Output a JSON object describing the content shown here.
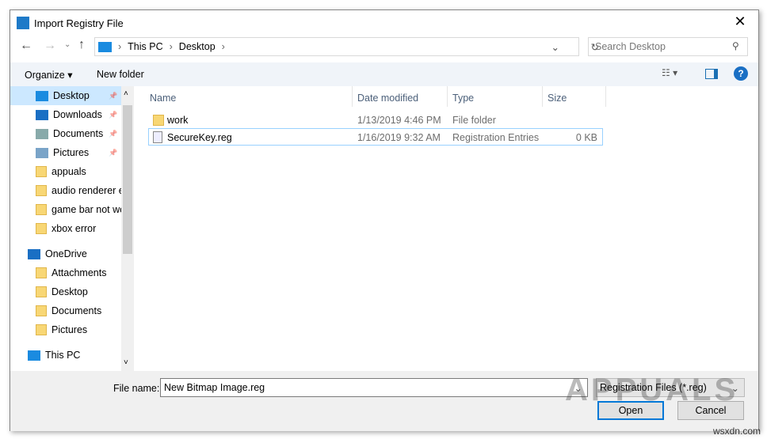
{
  "title": "Import Registry File",
  "close_label": "✕",
  "breadcrumb": [
    "This PC",
    "Desktop"
  ],
  "search_placeholder": "Search Desktop",
  "toolbar": {
    "organize": "Organize ▾",
    "new_folder": "New folder"
  },
  "sidebar": [
    {
      "label": "Desktop",
      "icon": "desktop",
      "pinned": true,
      "selected": true
    },
    {
      "label": "Downloads",
      "icon": "download",
      "pinned": true
    },
    {
      "label": "Documents",
      "icon": "documents",
      "pinned": true
    },
    {
      "label": "Pictures",
      "icon": "pictures",
      "pinned": true
    },
    {
      "label": "appuals",
      "icon": "folder"
    },
    {
      "label": "audio renderer e",
      "icon": "folder"
    },
    {
      "label": "game bar not wo",
      "icon": "folder"
    },
    {
      "label": "xbox error",
      "icon": "folder"
    },
    {
      "label": "OneDrive",
      "icon": "cloud"
    },
    {
      "label": "Attachments",
      "icon": "folder"
    },
    {
      "label": "Desktop",
      "icon": "folder"
    },
    {
      "label": "Documents",
      "icon": "folder"
    },
    {
      "label": "Pictures",
      "icon": "folder"
    },
    {
      "label": "This PC",
      "icon": "pc"
    }
  ],
  "columns": [
    "Name",
    "Date modified",
    "Type",
    "Size"
  ],
  "files": [
    {
      "name": "work",
      "date": "1/13/2019 4:46 PM",
      "type": "File folder",
      "size": ""
    },
    {
      "name": "SecureKey.reg",
      "date": "1/16/2019 9:32 AM",
      "type": "Registration Entries",
      "size": "0 KB"
    }
  ],
  "filename_label": "File name:",
  "filename_value": "New Bitmap Image.reg",
  "filetype": "Registration Files (*.reg)",
  "open": "Open",
  "cancel": "Cancel",
  "watermark": "APPUALS",
  "site": "wsxdn.com"
}
